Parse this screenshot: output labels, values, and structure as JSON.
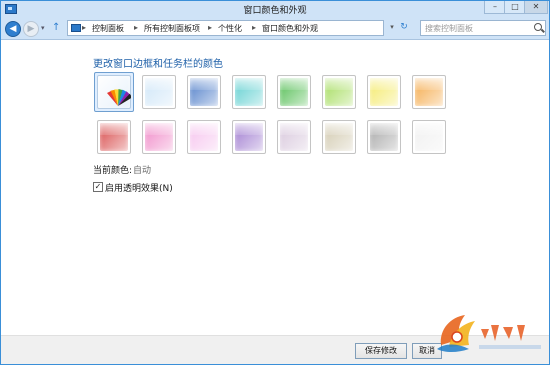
{
  "window": {
    "title": "窗口颜色和外观"
  },
  "titlebar": {
    "min_glyph": "–",
    "max_glyph": "□",
    "close_glyph": "✕"
  },
  "nav": {
    "back_glyph": "◀",
    "forward_glyph": "▶",
    "dropdown_glyph": "▾",
    "up_glyph": "↑",
    "breadcrumbs": [
      "控制面板",
      "所有控制面板项",
      "个性化",
      "窗口颜色和外观"
    ],
    "separator": "▸",
    "refresh_glyph": "↻",
    "address_dropdown_glyph": "▾"
  },
  "search": {
    "placeholder": "搜索控制面板"
  },
  "main": {
    "heading": "更改窗口边框和任务栏的颜色",
    "current_color_label": "当前颜色:",
    "current_color_value": "自动",
    "transparency_checkbox": {
      "checked": true,
      "glyph": "✓",
      "label": "启用透明效果(N)"
    }
  },
  "swatches": {
    "row1": [
      {
        "name": "automatic",
        "color": "#ffffff",
        "selected": true
      },
      {
        "name": "sky",
        "color": "#cfe6f8"
      },
      {
        "name": "blue",
        "color": "#4f7ec9"
      },
      {
        "name": "teal",
        "color": "#5fcfd0"
      },
      {
        "name": "green",
        "color": "#52bd52"
      },
      {
        "name": "lime",
        "color": "#a4dc5c"
      },
      {
        "name": "yellow",
        "color": "#f4ea6a"
      },
      {
        "name": "orange",
        "color": "#f5aa4a"
      }
    ],
    "row2": [
      {
        "name": "red",
        "color": "#d84a4a"
      },
      {
        "name": "pink",
        "color": "#f08ac8"
      },
      {
        "name": "light-pink",
        "color": "#f6c4ee"
      },
      {
        "name": "purple",
        "color": "#a07cd0"
      },
      {
        "name": "lavender",
        "color": "#d8c7dc"
      },
      {
        "name": "taupe",
        "color": "#d2cab0"
      },
      {
        "name": "gray",
        "color": "#a8a8a8"
      },
      {
        "name": "frost",
        "color": "#f0f0f0"
      }
    ]
  },
  "footer": {
    "save_label": "保存修改",
    "cancel_label": "取消"
  }
}
